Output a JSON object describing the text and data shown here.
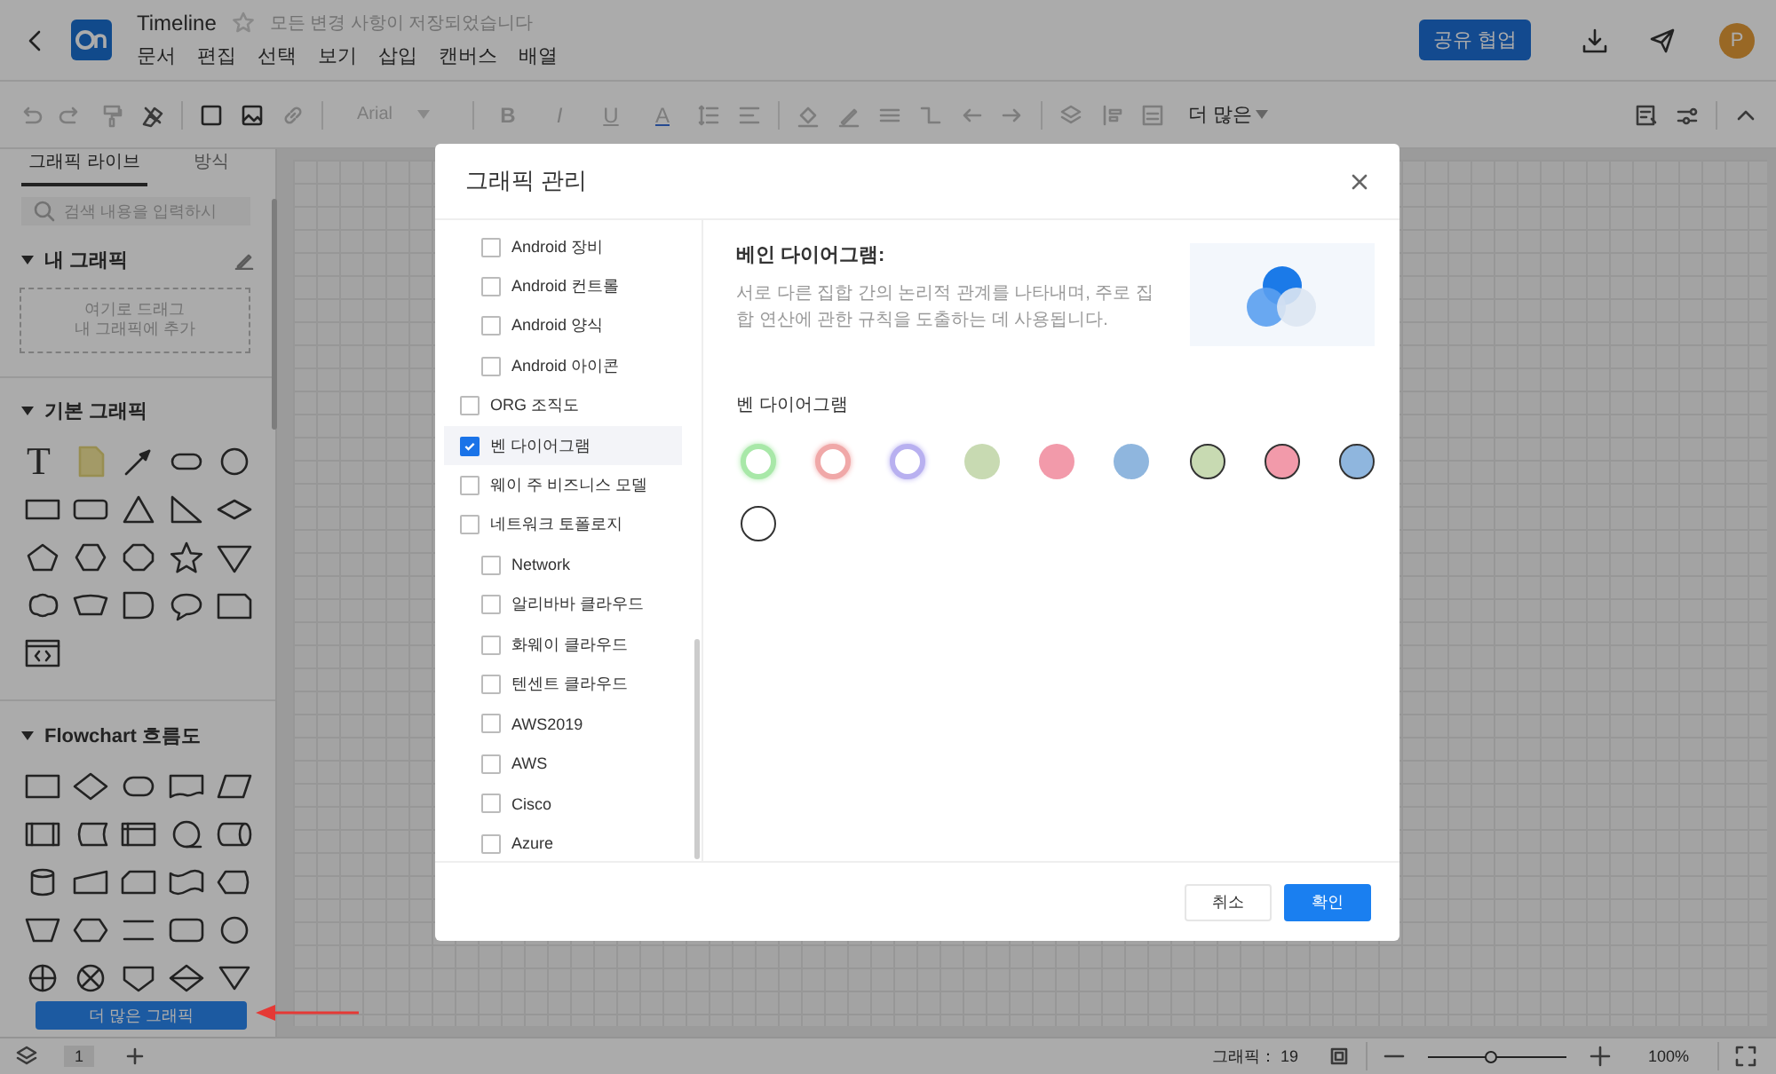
{
  "header": {
    "title": "Timeline",
    "favorite": false,
    "save_status": "모든 변경 사항이 저장되었습니다",
    "menu": [
      "문서",
      "편집",
      "선택",
      "보기",
      "삽입",
      "캔버스",
      "배열"
    ],
    "share_button": "공유 협업",
    "avatar": "P"
  },
  "toolbar": {
    "font": {
      "value": "Arial",
      "disabled": true
    },
    "text_styles": [
      {
        "label": "B",
        "kind": "bold",
        "disabled": true
      },
      {
        "label": "I",
        "kind": "italic",
        "disabled": true
      },
      {
        "label": "U",
        "kind": "underline",
        "disabled": true
      },
      {
        "label": "A",
        "kind": "color",
        "disabled": true
      }
    ],
    "more_button": "더 많은"
  },
  "sidebar": {
    "tabs": [
      {
        "label": "그래픽 라이브",
        "selected": true
      },
      {
        "label": "방식",
        "selected": false
      }
    ],
    "search": {
      "placeholder": "검색 내용을 입력하시"
    },
    "sections": [
      {
        "kind": "custom",
        "title": "내 그래픽",
        "expanded": true,
        "drop_hint": "여기로 드래그\n내 그래픽에 추가"
      },
      {
        "kind": "basic",
        "title": "기본 그래픽",
        "expanded": true,
        "text_glyph": "T"
      },
      {
        "kind": "flowchart",
        "title": "Flowchart 흐름도",
        "expanded": true
      }
    ],
    "more_button": "더 많은 그래픽"
  },
  "pages": {
    "current": "1"
  },
  "status_bar": {
    "shape_count": "그래픽： 19",
    "zoom_slider": {
      "level": 0.45
    },
    "zoom": "100%"
  },
  "callout_arrow": {
    "kind": "arrow"
  },
  "dialog": {
    "title": "그래픽 관리",
    "libraries": [
      {
        "children": [
          {
            "label": "Android 장비",
            "checked": false,
            "selected": false
          },
          {
            "label": "Android 컨트롤",
            "checked": false,
            "selected": false
          },
          {
            "label": "Android 양식",
            "checked": false,
            "selected": false
          },
          {
            "label": "Android 아이콘",
            "checked": false,
            "selected": false
          }
        ]
      },
      {
        "label": "ORG 조직도",
        "checked": false,
        "selected": false
      },
      {
        "label": "벤 다이어그램",
        "checked": true,
        "selected": true
      },
      {
        "label": "웨이 주 비즈니스 모델",
        "checked": false,
        "selected": false
      },
      {
        "label": "네트워크 토폴로지",
        "checked": false,
        "selected": false,
        "children": [
          {
            "label": "Network",
            "checked": false,
            "selected": false
          },
          {
            "label": "알리바바 클라우드",
            "checked": false,
            "selected": false
          },
          {
            "label": "화웨이 클라우드",
            "checked": false,
            "selected": false
          },
          {
            "label": "텐센트 클라우드",
            "checked": false,
            "selected": false
          },
          {
            "label": "AWS2019",
            "checked": false,
            "selected": false
          },
          {
            "label": "AWS",
            "checked": false,
            "selected": false
          },
          {
            "label": "Cisco",
            "checked": false,
            "selected": false
          },
          {
            "label": "Azure",
            "checked": false,
            "selected": false
          }
        ]
      }
    ],
    "detail": {
      "title": "베인 다이어그램:",
      "description": "서로 다른 집합 간의 논리적 관계를 나타내며, 주로 집합 연산에 관한 규칙을 도출하는 데 사용됩니다.",
      "shape_group": "벤 다이어그램",
      "shapes": [
        {
          "kind": "glow",
          "color": "#a8e8a8"
        },
        {
          "kind": "glow",
          "color": "#f0a8a8"
        },
        {
          "kind": "glow",
          "color": "#b8b0f0"
        },
        {
          "kind": "flat",
          "color": "#c8dab2"
        },
        {
          "kind": "flat",
          "color": "#f29aaa"
        },
        {
          "kind": "flat",
          "color": "#8fb6de"
        },
        {
          "kind": "outlined",
          "color": "#c8dab2"
        },
        {
          "kind": "outlined",
          "color": "#f29aaa"
        },
        {
          "kind": "outlined",
          "color": "#8fb6de"
        },
        {
          "kind": "outlined",
          "color": "#ffffff"
        }
      ]
    },
    "buttons": [
      {
        "label": "취소",
        "kind": "secondary"
      },
      {
        "label": "확인",
        "kind": "primary"
      }
    ]
  }
}
